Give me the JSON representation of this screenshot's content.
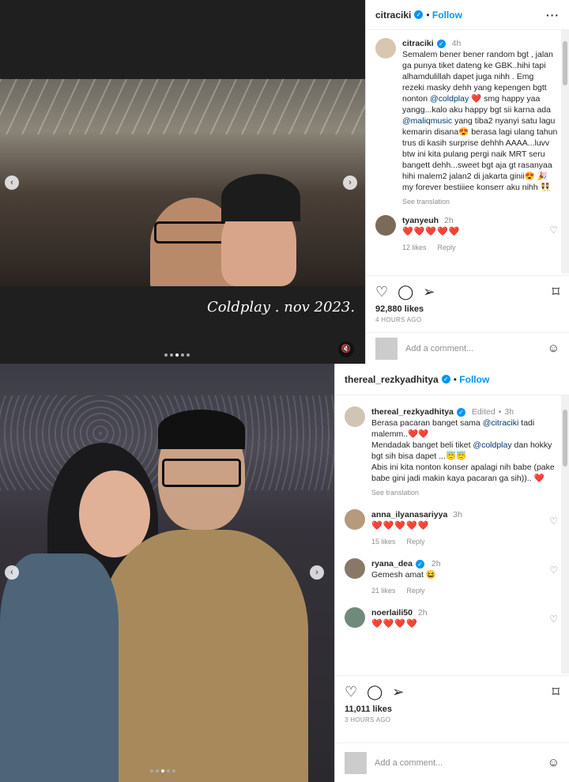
{
  "post1": {
    "username": "citraciki",
    "follow": "Follow",
    "caption_user": "citraciki",
    "caption_time": "4h",
    "caption_parts": [
      "Semalem bener bener random bgt , jalan ga punya tiket dateng ke GBK..hihi tapi alhamdulillah dapet juga nihh . Emg rezeki masky dehh yang kepengen bgtt nonton ",
      "@coldplay",
      " ❤️ smg happy yaa yangg...kalo aku happy bgt sii karna ada ",
      "@maliqmusic",
      " yang tiba2 nyanyi satu lagu kemarin disana😍 berasa lagi ulang tahun trus di kasih surprise dehhh AAAA...luvv btw ini kita pulang pergi naik MRT seru bangett dehh...sweet bgt aja gt rasanyaa hihi malem2 jalan2 di jakarta ginii😍 🎉 my forever bestiiiee konserr aku nihh 👯"
    ],
    "see_translation": "See translation",
    "comment": {
      "user": "tyanyeuh",
      "time": "2h",
      "text": "❤️❤️❤️❤️❤️",
      "likes": "12 likes",
      "reply": "Reply"
    },
    "likes": "92,880 likes",
    "ago": "4 HOURS AGO",
    "add_comment": "Add a comment...",
    "photo_caption": "Coldplay . nov 2023."
  },
  "post2": {
    "username": "thereal_rezkyadhitya",
    "follow": "Follow",
    "caption_user": "thereal_rezkyadhitya",
    "caption_edited": "Edited",
    "caption_time": "3h",
    "caption_parts": [
      "Berasa pacaran banget sama ",
      "@citraciki",
      " tadi malemm..❤️❤️\nMendadak banget beli tiket ",
      "@coldplay",
      " dan hokky bgt sih bisa dapet ...😇😇\nAbis ini kita nonton konser apalagi nih babe (pake babe gini jadi makin kaya pacaran ga sih)).. ❤️"
    ],
    "see_translation": "See translation",
    "comments": [
      {
        "user": "anna_ilyanasariyya",
        "time": "3h",
        "text": "❤️❤️❤️❤️❤️",
        "likes": "15 likes",
        "reply": "Reply"
      },
      {
        "user": "ryana_dea",
        "time": "2h",
        "text": "Gemesh amat 😆",
        "likes": "21 likes",
        "reply": "Reply"
      },
      {
        "user": "noerlaili50",
        "time": "2h",
        "text": "❤️❤️❤️❤️",
        "likes": "",
        "reply": ""
      }
    ],
    "likes": "11,011 likes",
    "ago": "3 HOURS AGO",
    "add_comment": "Add a comment..."
  },
  "colors": {
    "accent": "#0095f6",
    "heart": "#ed1c24",
    "muted": "#8e8e8e"
  }
}
